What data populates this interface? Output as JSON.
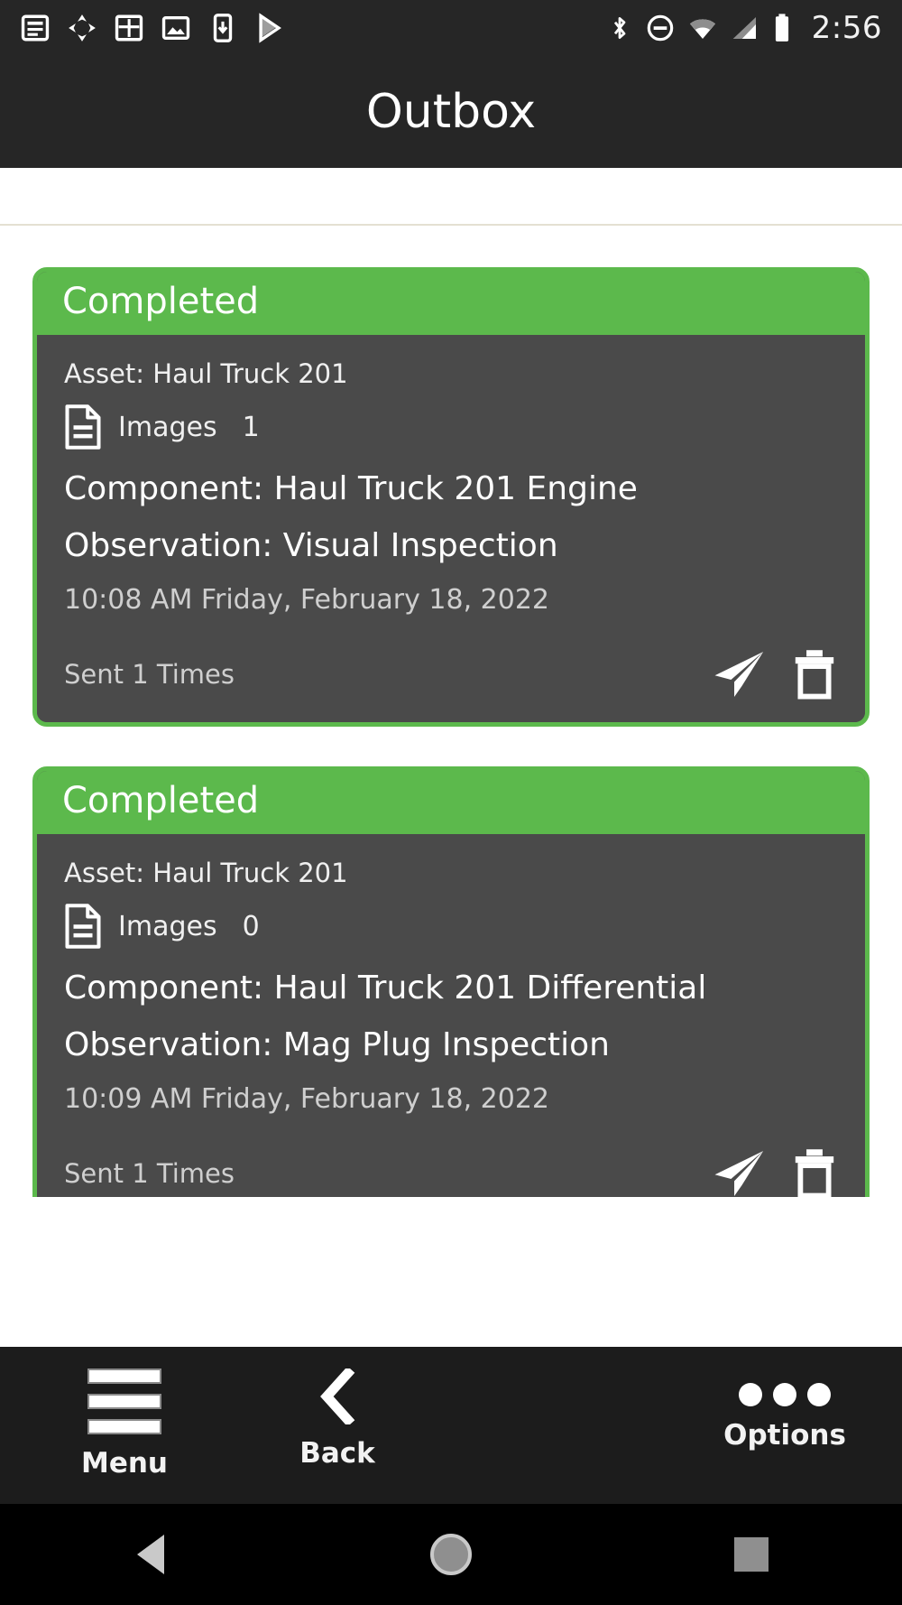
{
  "statusbar": {
    "time": "2:56",
    "notification_icons": [
      "list-document-icon",
      "sync-icon",
      "grid-table-icon",
      "photo-icon",
      "download-phone-icon",
      "play-store-icon"
    ],
    "system_icons": [
      "bluetooth-icon",
      "do-not-disturb-icon",
      "wifi-icon",
      "cell-signal-icon",
      "battery-icon"
    ]
  },
  "header": {
    "title": "Outbox"
  },
  "cards": [
    {
      "status": "Completed",
      "asset": "Asset: Haul Truck 201",
      "images_label": "Images",
      "images_count": "1",
      "component": "Component: Haul Truck 201 Engine",
      "observation": "Observation: Visual Inspection",
      "timestamp": "10:08 AM Friday, February 18, 2022",
      "sent": "Sent 1 Times",
      "actions": [
        "send-icon",
        "delete-icon"
      ]
    },
    {
      "status": "Completed",
      "asset": "Asset: Haul Truck 201",
      "images_label": "Images",
      "images_count": "0",
      "component": "Component: Haul Truck 201 Differential",
      "observation": "Observation: Mag Plug Inspection",
      "timestamp": "10:09 AM Friday, February 18, 2022",
      "sent": "Sent 1 Times",
      "actions": [
        "send-icon",
        "delete-icon"
      ]
    }
  ],
  "toolbar": {
    "menu_label": "Menu",
    "back_label": "Back",
    "options_label": "Options"
  },
  "navbar": {
    "buttons": [
      "back-triangle-icon",
      "home-circle-icon",
      "recents-square-icon"
    ]
  },
  "colors": {
    "status_green": "#5cb94c",
    "card_body": "#4a4a4a",
    "chrome_dark": "#262626",
    "toolbar_dark": "#1c1c1c"
  }
}
